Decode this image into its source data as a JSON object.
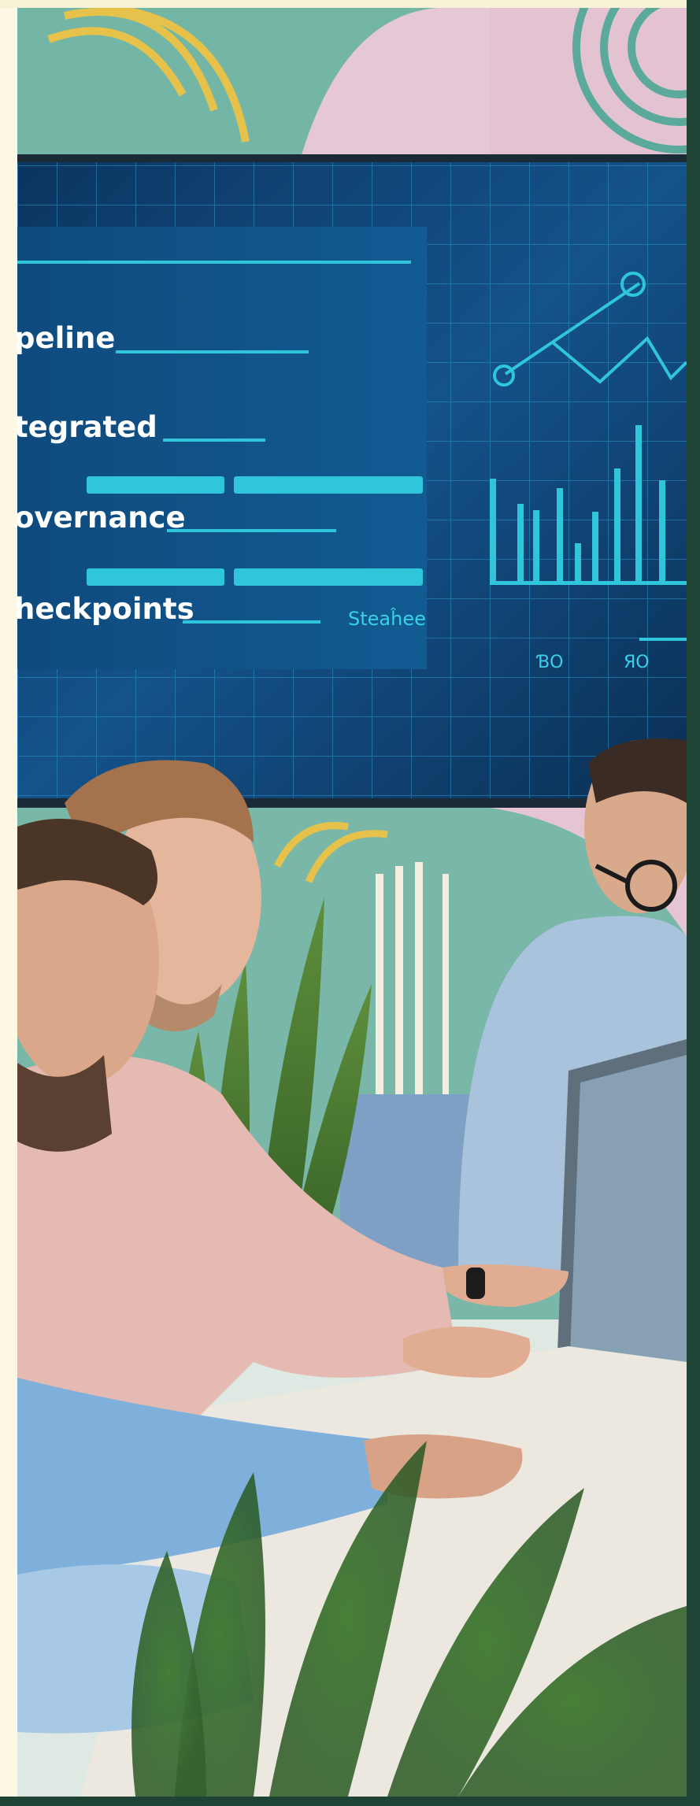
{
  "screen": {
    "labels": [
      "peline",
      "tegrated",
      "overnance",
      "heckpoints"
    ],
    "caption": "Steaĥee",
    "axis_labels": [
      "ƁO",
      "ЯO"
    ]
  },
  "colors": {
    "frame": "#1f4436",
    "screen_bg": "#0e3b63",
    "screen_accent": "#2fc6dc",
    "wall_teal": "#6fb6a8",
    "wall_pink": "#e7c6d4",
    "wall_yellow": "#e8c04a"
  }
}
